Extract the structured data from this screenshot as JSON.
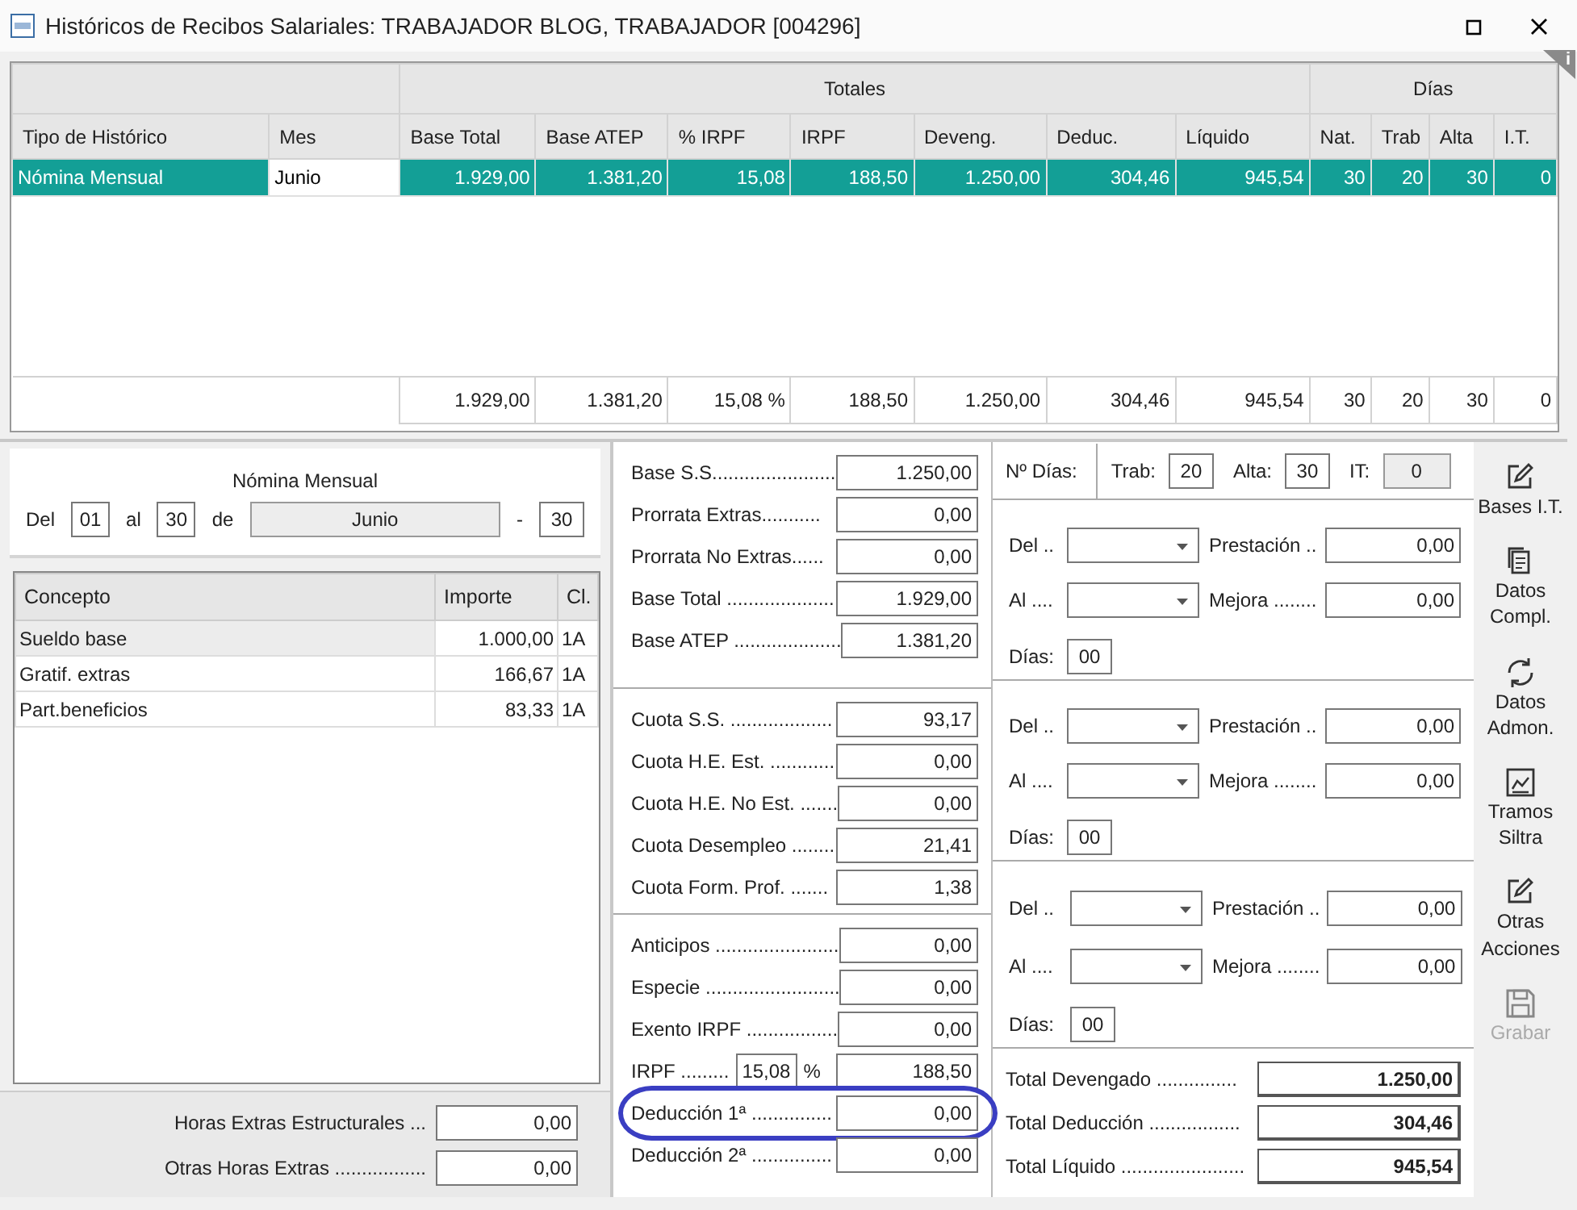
{
  "window": {
    "title": "Históricos de Recibos Salariales: TRABAJADOR BLOG, TRABAJADOR [004296]"
  },
  "info_marker": "i",
  "history_table": {
    "group_headers": [
      {
        "label": "Totales"
      },
      {
        "label": "Días"
      }
    ],
    "columns": [
      "Tipo de Histórico",
      "Mes",
      "Base Total",
      "Base ATEP",
      "% IRPF",
      "IRPF",
      "Deveng.",
      "Deduc.",
      "Líquido",
      "Nat.",
      "Trab",
      "Alta",
      "I.T."
    ],
    "rows": [
      {
        "selected": true,
        "cells": [
          "Nómina Mensual",
          "Junio",
          "1.929,00",
          "1.381,20",
          "15,08",
          "188,50",
          "1.250,00",
          "304,46",
          "945,54",
          "30",
          "20",
          "30",
          "0"
        ]
      }
    ],
    "totals": [
      "1.929,00",
      "1.381,20",
      "15,08 %",
      "188,50",
      "1.250,00",
      "304,46",
      "945,54",
      "30",
      "20",
      "30",
      "0"
    ]
  },
  "period": {
    "title": "Nómina Mensual",
    "from_label": "Del",
    "from": "01",
    "to_label": "al",
    "to": "30",
    "month_label": "de",
    "month": "Junio",
    "dash": "-",
    "last": "30"
  },
  "concepts": {
    "columns": [
      "Concepto",
      "Importe",
      "Cl."
    ],
    "rows": [
      {
        "selected": true,
        "cells": [
          "Sueldo base",
          "1.000,00",
          "1A"
        ]
      },
      {
        "selected": false,
        "cells": [
          "Gratif. extras",
          "166,67",
          "1A"
        ]
      },
      {
        "selected": false,
        "cells": [
          "Part.beneficios",
          "83,33",
          "1A"
        ]
      }
    ]
  },
  "overtime": [
    {
      "label": "Horas Extras Estructurales ...",
      "value": "0,00"
    },
    {
      "label": "Otras Horas Extras .................",
      "value": "0,00"
    }
  ],
  "bases": [
    {
      "label": "Base S.S.......................",
      "value": "1.250,00"
    },
    {
      "label": "Prorrata Extras...........",
      "value": "0,00"
    },
    {
      "label": "Prorrata No Extras......",
      "value": "0,00"
    },
    {
      "label": "Base Total ....................",
      "value": "1.929,00"
    },
    {
      "label": "Base ATEP ....................",
      "value": "1.381,20"
    }
  ],
  "cuotas": [
    {
      "label": "Cuota S.S. ...................",
      "value": "93,17"
    },
    {
      "label": "Cuota H.E. Est. ............",
      "value": "0,00"
    },
    {
      "label": "Cuota H.E. No Est. .......",
      "value": "0,00"
    },
    {
      "label": "Cuota Desempleo ........",
      "value": "21,41"
    },
    {
      "label": "Cuota Form. Prof. .......",
      "value": "1,38"
    }
  ],
  "deductions": [
    {
      "kind": "field",
      "label": "Anticipos .......................",
      "value": "0,00",
      "highlighted": false
    },
    {
      "kind": "field",
      "label": "Especie .........................",
      "value": "0,00",
      "highlighted": false
    },
    {
      "kind": "field",
      "label": "Exento IRPF .................",
      "value": "0,00",
      "highlighted": false
    },
    {
      "kind": "percent",
      "label": "IRPF .........",
      "percent": "15,08",
      "percent_sign": "%",
      "value": "188,50",
      "highlighted": false
    },
    {
      "kind": "field",
      "label": "Deducción 1ª ...............",
      "value": "0,00",
      "highlighted": true
    },
    {
      "kind": "field",
      "label": "Deducción 2ª ...............",
      "value": "0,00",
      "highlighted": false
    }
  ],
  "days": {
    "label": "Nº Días:",
    "fields": [
      {
        "label": "Trab:",
        "value": "20",
        "disabled": false
      },
      {
        "label": "Alta:",
        "value": "30",
        "disabled": false
      },
      {
        "label": "IT:",
        "value": "0",
        "disabled": true
      }
    ]
  },
  "it_periods": [
    {
      "del_label": "Del ..",
      "al_label": "Al ....",
      "dias_label": "Días:",
      "dias": "00",
      "prestacion_label": "Prestación ..",
      "prestacion": "0,00",
      "mejora_label": "Mejora ........",
      "mejora": "0,00"
    },
    {
      "del_label": "Del ..",
      "al_label": "Al ....",
      "dias_label": "Días:",
      "dias": "00",
      "prestacion_label": "Prestación ..",
      "prestacion": "0,00",
      "mejora_label": "Mejora ........",
      "mejora": "0,00"
    },
    {
      "del_label": "Del ..",
      "al_label": "Al ....",
      "dias_label": "Días:",
      "dias": "00",
      "prestacion_label": "Prestación ..",
      "prestacion": "0,00",
      "mejora_label": "Mejora ........",
      "mejora": "0,00"
    }
  ],
  "totals": [
    {
      "label": "Total Devengado ...............",
      "value": "1.250,00"
    },
    {
      "label": "Total Deducción .................",
      "value": "304,46"
    },
    {
      "label": "Total Líquido .......................",
      "value": "945,54"
    }
  ],
  "actions": [
    {
      "kind": "edit",
      "label": "Bases I.T.",
      "disabled": false
    },
    {
      "kind": "document",
      "label": "Datos Compl.",
      "disabled": false
    },
    {
      "kind": "refresh",
      "label": "Datos Admon.",
      "disabled": false
    },
    {
      "kind": "chart",
      "label": "Tramos Siltra",
      "disabled": false
    },
    {
      "kind": "edit",
      "label": "Otras Acciones",
      "disabled": false
    },
    {
      "kind": "save",
      "label": "Grabar",
      "disabled": true
    }
  ]
}
